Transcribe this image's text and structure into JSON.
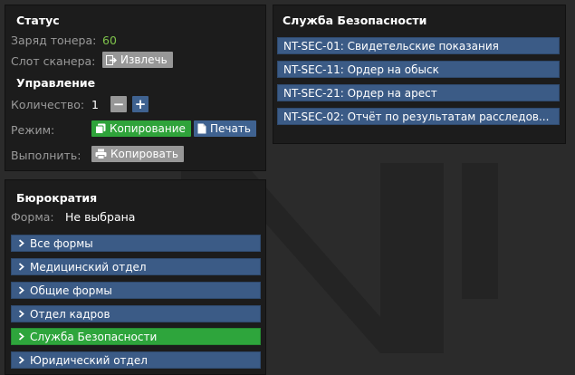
{
  "status": {
    "title": "Статус",
    "toner_label": "Заряд тонера:",
    "toner_value": "60",
    "scanner_label": "Слот сканера:",
    "eject_button": "Извлечь"
  },
  "control": {
    "title": "Управление",
    "quantity_label": "Количество:",
    "quantity_value": "1",
    "minus": "−",
    "plus": "+",
    "mode_label": "Режим:",
    "mode_copy": "Копирование",
    "mode_print": "Печать",
    "execute_label": "Выполнить:",
    "execute_button": "Копировать"
  },
  "bureaucracy": {
    "title": "Бюрократия",
    "form_label": "Форма:",
    "form_value": "Не выбрана",
    "items": [
      {
        "label": "Все формы",
        "active": false
      },
      {
        "label": "Медицинский отдел",
        "active": false
      },
      {
        "label": "Общие формы",
        "active": false
      },
      {
        "label": "Отдел кадров",
        "active": false
      },
      {
        "label": "Служба Безопасности",
        "active": true
      },
      {
        "label": "Юридический отдел",
        "active": false
      }
    ]
  },
  "security": {
    "title": "Служба Безопасности",
    "items": [
      "NT-SEC-01: Свидетельские показания",
      "NT-SEC-11: Ордер на обыск",
      "NT-SEC-21: Ордер на арест",
      "NT-SEC-02: Отчёт по результатам расследов..."
    ]
  },
  "colors": {
    "background": "#2b2b2b",
    "panel": "#1c1c1c",
    "blue": "#3b5b86",
    "green": "#2ea53c",
    "grey": "#979797",
    "toner_green": "#7ec24b"
  }
}
